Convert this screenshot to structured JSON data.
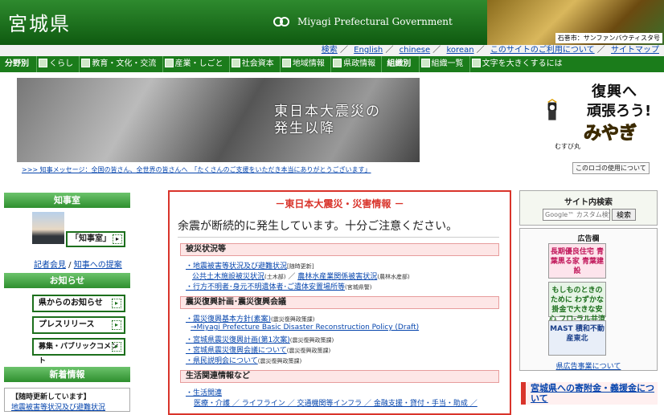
{
  "header": {
    "logo": "宮城県",
    "govt": "Miyagi Prefectural Government",
    "photo_caption": "石巻市：サンファンバウティスタ号"
  },
  "util": [
    "検索",
    "English",
    "chinese",
    "korean",
    "このサイトのご利用について",
    "サイトマップ"
  ],
  "nav": {
    "head1": "分野別",
    "items1": [
      "くらし",
      "教育・文化・交流",
      "産業・しごと",
      "社会資本",
      "地域情報",
      "県政情報"
    ],
    "head2": "組織別",
    "items2": [
      "組織一覧",
      "文字を大きくするには"
    ]
  },
  "banner": {
    "title1": "東日本大震災の",
    "title2": "発生以降",
    "msg": ">>> 知事メッセージ：全国の皆さん、全世界の皆さんへ　「たくさんのご支援をいただき本当にありがとうございます」"
  },
  "mascot": {
    "t1": "復興へ",
    "t2": "頑張ろう!",
    "t3": "みやぎ",
    "name": "むすび丸",
    "logo_use": "このロゴの使用について"
  },
  "left": {
    "chiji": "知事室",
    "chiji_btn": "「知事室」",
    "link1": "記者会見",
    "link2": "知事への提案",
    "oshirase": "お知らせ",
    "btn1": "県からのお知らせ",
    "btn2": "プレスリリース",
    "btn3": "募集・パブリックコメント",
    "shinchaku": "新着情報",
    "news_head": "【随時更新しています】",
    "news_item": "地震被害等状況及び避難状況"
  },
  "center": {
    "title": "－東日本大震災・災害情報 －",
    "warn": "余震が断続的に発生しています。十分ご注意ください。",
    "sec1": "被災状況等",
    "l1": "・地震被害等状況及び避難状況",
    "l1s": "[随時更新]",
    "l2": "公共土木施設被災状況",
    "l2s": "(土木部)",
    "l3": "農林水産業関係被害状況",
    "l3s": "(農林水産部)",
    "l4": "・行方不明者･身元不明遺体者･ご遺体安置場所等",
    "l4s": "(宮城県警)",
    "sec2": "震災復興計画･震災復興会議",
    "l5": "・震災復興基本方針(素案)",
    "l5s": "(震災復興政策課)",
    "l6": "→Miyagi Prefecture Basic Disaster Reconstruction Policy (Draft)",
    "l7": "・宮城県震災復興計画(第1次案)",
    "l7s": "(震災復興政策課)",
    "l8": "・宮城県震災復興会議について",
    "l8s": "(震災復興政策課)",
    "l9": "・県民説明会について",
    "l9s": "(震災復興政策課)",
    "sec3": "生活関連情報など",
    "l10": "・生活関連",
    "l11": "医療・介護 ／ ライフライン ／ 交通機関等インフラ ／ 金融支援・貸付・手当・助成 ／"
  },
  "right": {
    "search_title": "サイト内検索",
    "search_placeholder": "Google™ カスタム検索",
    "search_btn": "検索",
    "ad_title": "広告欄",
    "ad1": "長期優良住宅 青葉黒る家 青葉建設",
    "ad2": "もしものときのために わずかな掛金で大きな安心 フロ-ラル共済",
    "ad3": "MAST 積和不動産東北",
    "ad_link": "県広告事業について",
    "donate": "宮城県への寄附金・義援金について"
  }
}
